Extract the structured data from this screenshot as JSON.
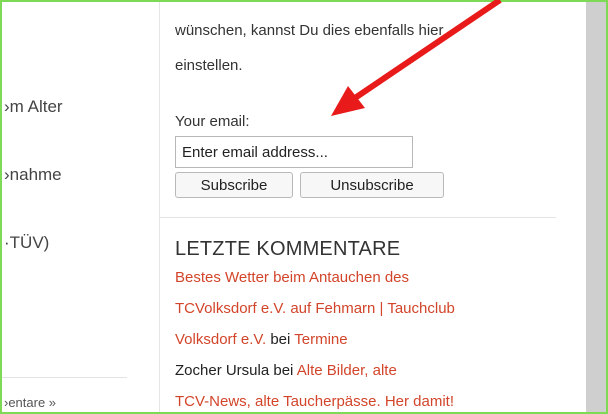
{
  "sidebar": {
    "items": [
      {
        "label": "›m Alter"
      },
      {
        "label": "›nahme"
      },
      {
        "label": "·TÜV)"
      }
    ],
    "footer_label": "›entare »"
  },
  "newsletter": {
    "text_lines": [
      "wünschen, kannst Du dies ebenfalls hier",
      "einstellen."
    ],
    "email_label": "Your email:",
    "email_placeholder": "Enter email address...",
    "subscribe_label": "Subscribe",
    "unsubscribe_label": "Unsubscribe"
  },
  "comments": {
    "title": "LETZTE KOMMENTARE",
    "line1": "Bestes Wetter beim Antauchen des",
    "line2": "TCVolksdorf e.V. auf Fehmarn | Tauchclub",
    "line3_link": "Volksdorf e.V.",
    "line3_text": " bei ",
    "line3_link2": "Termine",
    "line4_author": "Zocher Ursula",
    "line4_text": " bei ",
    "line4_link": "Alte Bilder, alte",
    "line5_link": "TCV-News, alte Taucherpässe. Her damit!"
  },
  "colors": {
    "border": "#7ed957",
    "link": "#d2452a",
    "arrow": "#e81a1a"
  }
}
